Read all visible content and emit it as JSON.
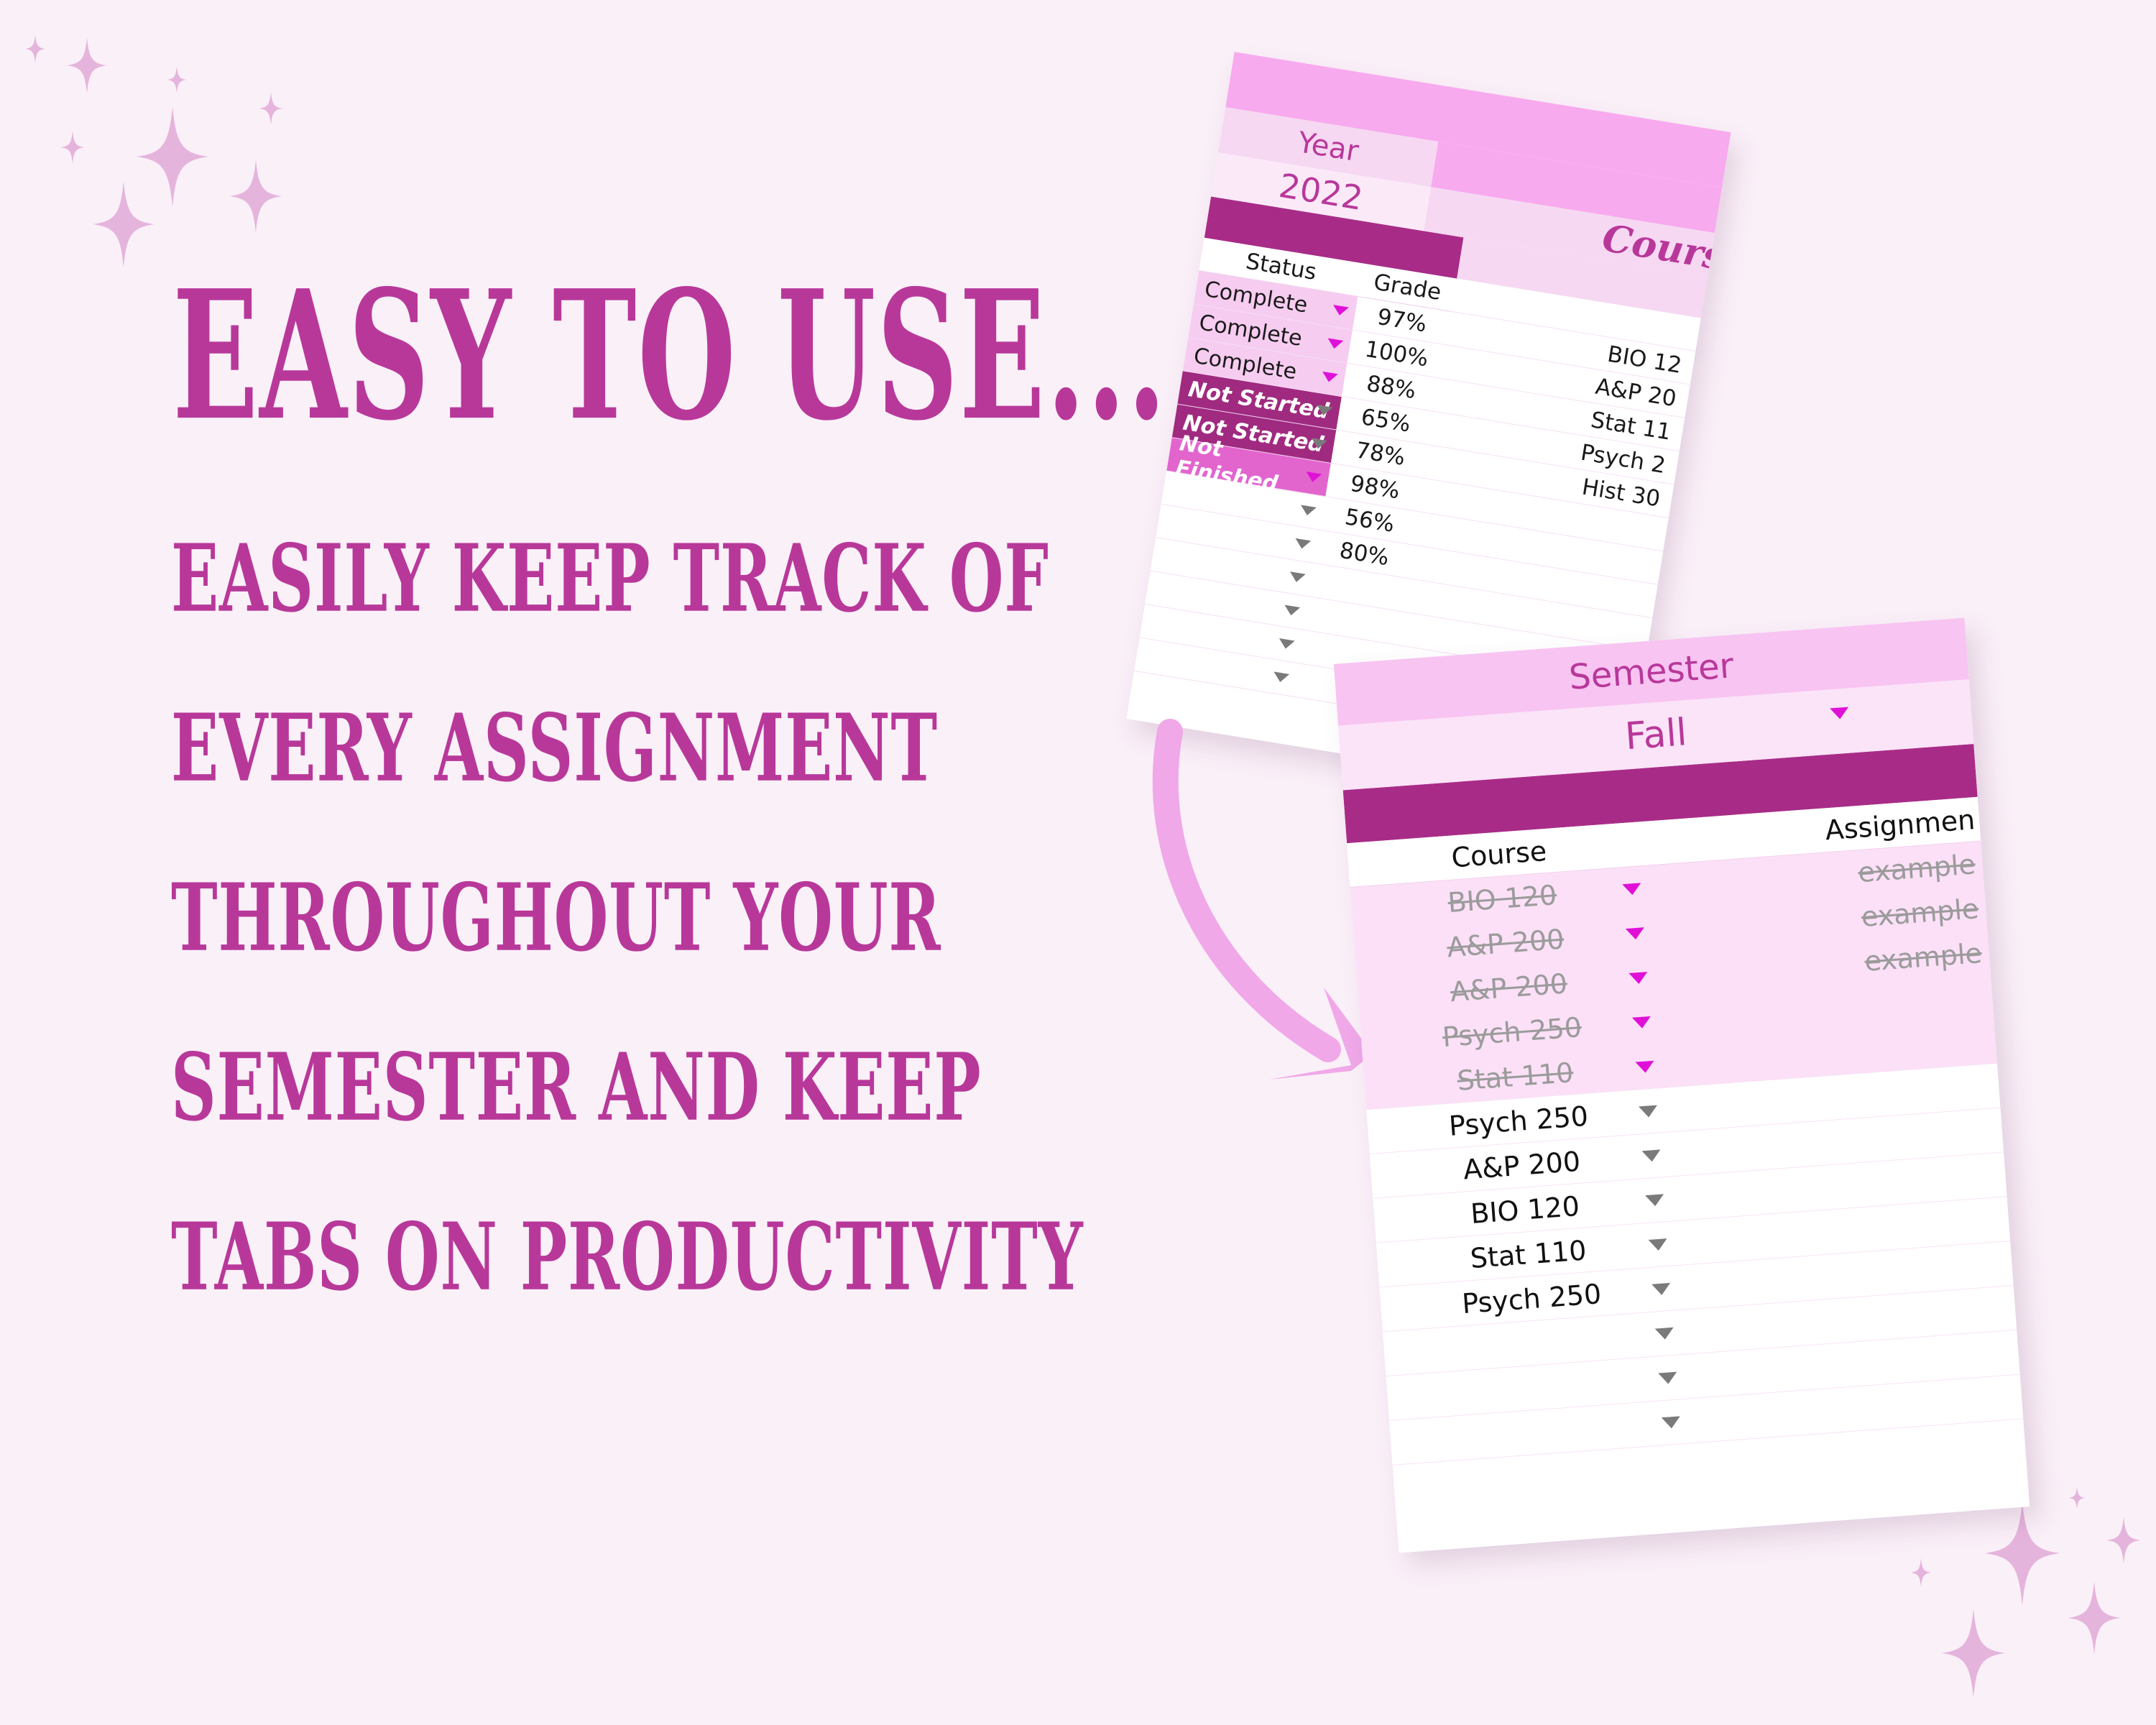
{
  "theme": {
    "background": "#FAF0F8",
    "accent_magenta": "#B8389A",
    "band_dark": "#A82C87",
    "band_pink": "#F8AAEE",
    "sparkle_pink": "#E5B4DC",
    "arrow_pink": "#F0A8E8"
  },
  "marketing": {
    "headline": "EASY TO USE...",
    "body_lines": [
      "EASILY KEEP TRACK OF",
      "EVERY ASSIGNMENT",
      "THROUGHOUT YOUR",
      "SEMESTER AND KEEP",
      "TABS ON PRODUCTIVITY"
    ]
  },
  "card_year": {
    "field_label": "Year",
    "field_value": "2022",
    "section_title": "Cours",
    "headers": {
      "status": "Status",
      "grade": "Grade"
    },
    "status_rows": [
      {
        "label": "Complete",
        "state": "complete"
      },
      {
        "label": "Complete",
        "state": "complete"
      },
      {
        "label": "Complete",
        "state": "complete"
      },
      {
        "label": "Not Started",
        "state": "notstarted"
      },
      {
        "label": "Not Started",
        "state": "notstarted"
      },
      {
        "label": "Not Finished",
        "state": "notfinished"
      },
      {
        "label": "",
        "state": "empty"
      },
      {
        "label": "",
        "state": "empty"
      },
      {
        "label": "",
        "state": "empty"
      },
      {
        "label": "",
        "state": "empty"
      },
      {
        "label": "",
        "state": "empty"
      },
      {
        "label": "",
        "state": "empty"
      }
    ],
    "grades": [
      "97%",
      "100%",
      "88%",
      "65%",
      "78%",
      "98%",
      "56%",
      "80%",
      "",
      "",
      "",
      ""
    ],
    "courses": [
      "BIO 12",
      "A&P 20",
      "Stat 11",
      "Psych 2",
      "Hist 30",
      "",
      "",
      "",
      "",
      "",
      "",
      ""
    ]
  },
  "card_semester": {
    "field_label": "Semester",
    "field_value": "Fall",
    "headers": {
      "course": "Course",
      "assignment": "Assignmen"
    },
    "course_rows": [
      {
        "text": "BIO 120",
        "struck": true
      },
      {
        "text": "A&P 200",
        "struck": true
      },
      {
        "text": "A&P 200",
        "struck": true
      },
      {
        "text": "Psych 250",
        "struck": true
      },
      {
        "text": "Stat 110",
        "struck": true
      },
      {
        "text": "Psych 250",
        "struck": false
      },
      {
        "text": "A&P 200",
        "struck": false
      },
      {
        "text": "BIO 120",
        "struck": false
      },
      {
        "text": "Stat 110",
        "struck": false
      },
      {
        "text": "Psych 250",
        "struck": false
      },
      {
        "text": "",
        "struck": false
      },
      {
        "text": "",
        "struck": false
      },
      {
        "text": "",
        "struck": false
      }
    ],
    "assignment_rows": [
      {
        "text": "example",
        "struck": true
      },
      {
        "text": "example",
        "struck": true
      },
      {
        "text": "example",
        "struck": true
      },
      {
        "text": "",
        "struck": false
      },
      {
        "text": "",
        "struck": false
      },
      {
        "text": "",
        "struck": false
      },
      {
        "text": "",
        "struck": false
      },
      {
        "text": "",
        "struck": false
      },
      {
        "text": "",
        "struck": false
      },
      {
        "text": "",
        "struck": false
      },
      {
        "text": "",
        "struck": false
      },
      {
        "text": "",
        "struck": false
      },
      {
        "text": "",
        "struck": false
      }
    ]
  }
}
